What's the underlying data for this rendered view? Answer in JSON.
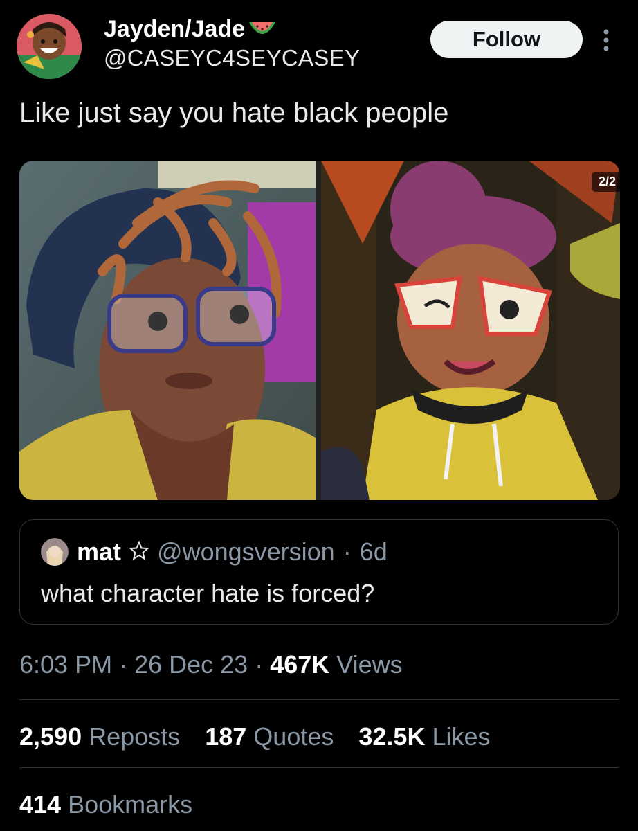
{
  "header": {
    "display_name": "Jayden/Jade",
    "handle": "@CASEYC4SEYCASEY",
    "follow_label": "Follow"
  },
  "tweet": {
    "text": "Like just say you hate black people"
  },
  "media": {
    "counter": "2/2"
  },
  "quoted_tweet": {
    "name": "mat",
    "handle": "@wongsversion",
    "age": "6d",
    "text": "what character hate is forced?"
  },
  "meta": {
    "time": "6:03 PM",
    "date": "26 Dec 23",
    "views_count": "467K",
    "views_label": "Views"
  },
  "stats": {
    "reposts_count": "2,590",
    "reposts_label": "Reposts",
    "quotes_count": "187",
    "quotes_label": "Quotes",
    "likes_count": "32.5K",
    "likes_label": "Likes",
    "bookmarks_count": "414",
    "bookmarks_label": "Bookmarks"
  },
  "colors": {
    "background": "#000000",
    "text_primary": "#e7e9ea",
    "text_secondary": "#8b98a5",
    "divider": "#2f3336",
    "follow_button_bg": "#eff3f4"
  },
  "icons": {
    "watermelon": "watermelon-emoji-icon",
    "more": "more-options-icon",
    "star": "star-icon"
  }
}
